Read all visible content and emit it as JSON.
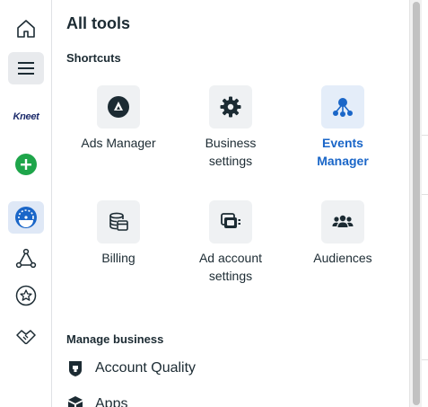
{
  "rail": {
    "brand": "Kneet",
    "icons": [
      "home-icon",
      "menu-icon",
      "brand-logo",
      "add-icon",
      "dashboard-icon",
      "network-icon",
      "star-badge-icon",
      "handshake-icon"
    ]
  },
  "panel": {
    "title": "All tools",
    "shortcuts_title": "Shortcuts",
    "shortcuts": [
      {
        "label": "Ads Manager",
        "icon": "ads-manager-icon"
      },
      {
        "label": "Business settings",
        "icon": "gear-icon"
      },
      {
        "label": "Events Manager",
        "icon": "events-manager-icon",
        "highlighted": true
      },
      {
        "label": "Billing",
        "icon": "billing-icon"
      },
      {
        "label": "Ad account settings",
        "icon": "ad-account-settings-icon"
      },
      {
        "label": "Audiences",
        "icon": "audiences-icon"
      }
    ],
    "manage_title": "Manage business",
    "manage_items": [
      {
        "label": "Account Quality",
        "icon": "shield-icon"
      },
      {
        "label": "Apps",
        "icon": "cube-icon"
      }
    ]
  },
  "colors": {
    "accent": "#1a66c8",
    "add_green": "#1ea54a",
    "text": "#1c2b33",
    "icon_tile": "#eff1f3"
  }
}
